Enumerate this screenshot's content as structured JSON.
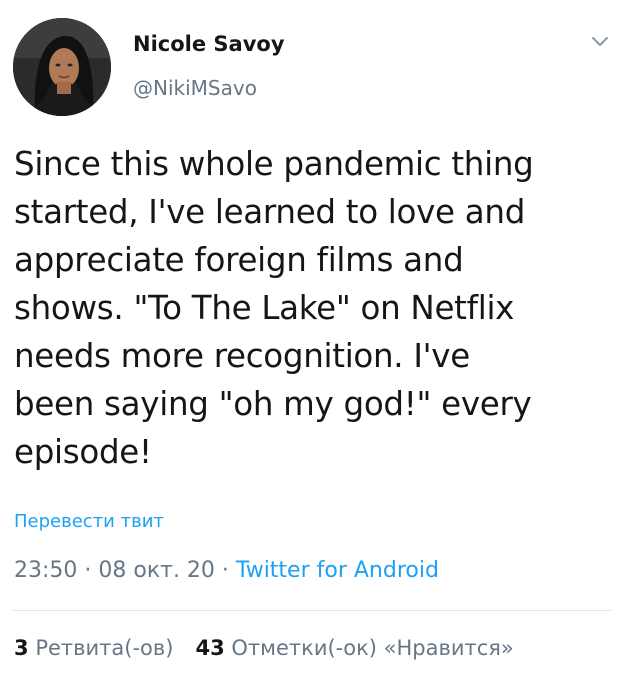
{
  "author": {
    "display_name": "Nicole Savoy",
    "handle": "@NikiMSavo"
  },
  "tweet": {
    "text": "Since this whole pandemic thing\nstarted, I've learned to love and\nappreciate foreign films and\nshows. \"To The Lake\" on Netflix\nneeds more recognition. I've\nbeen saying \"oh my god!\" every\nepisode!",
    "translate_label": "Перевести твит"
  },
  "meta": {
    "time": "23:50",
    "separator": " · ",
    "date": "08 окт. 20",
    "source": "Twitter for Android"
  },
  "stats": {
    "retweets_count": "3",
    "retweets_label": "Ретвита(-ов)",
    "likes_count": "43",
    "likes_label": "Отметки(-ок) «Нравится»"
  },
  "icons": {
    "menu": "chevron-down-icon",
    "avatar": "profile-photo"
  },
  "colors": {
    "link": "#1da1f2",
    "secondary_text": "#657786",
    "primary_text": "#14171a"
  }
}
